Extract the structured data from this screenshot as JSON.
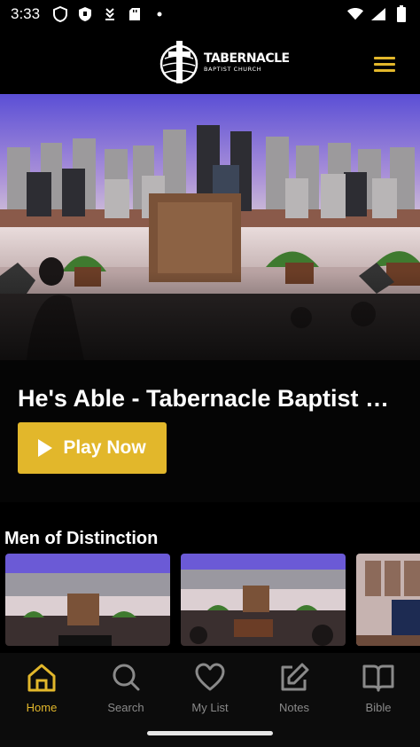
{
  "status_bar": {
    "time": "3:33",
    "left_icons": [
      "shield-icon",
      "shield-filled-icon",
      "download-icon",
      "sd-card-icon",
      "dot-icon"
    ],
    "right_icons": [
      "wifi-icon",
      "signal-icon",
      "battery-icon"
    ]
  },
  "header": {
    "logo_line1": "TABERNACLE",
    "logo_line2": "BAPTIST CHURCH",
    "menu_icon": "hamburger-menu-icon"
  },
  "hero": {
    "title": "He's Able - Tabernacle Baptist Church",
    "play_label": "Play Now"
  },
  "section": {
    "title": "Men of Distinction"
  },
  "nav": {
    "items": [
      {
        "label": "Home",
        "icon": "home-icon",
        "active": true
      },
      {
        "label": "Search",
        "icon": "search-icon",
        "active": false
      },
      {
        "label": "My List",
        "icon": "heart-icon",
        "active": false
      },
      {
        "label": "Notes",
        "icon": "edit-note-icon",
        "active": false
      },
      {
        "label": "Bible",
        "icon": "book-icon",
        "active": false
      }
    ]
  },
  "colors": {
    "accent": "#e2b72b",
    "background": "#000000",
    "nav_background": "#0c0c0c",
    "inactive": "#8a8a8a"
  }
}
